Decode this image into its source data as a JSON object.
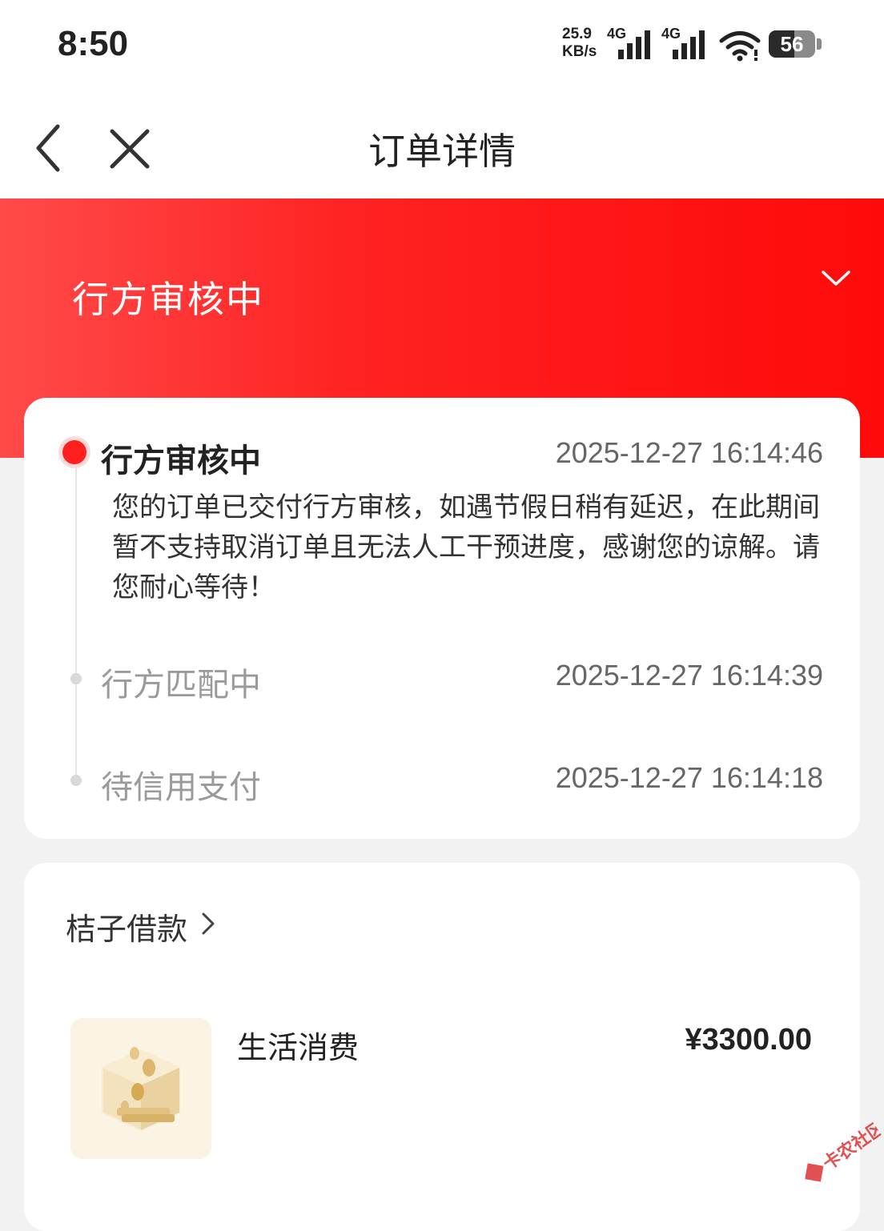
{
  "status_bar": {
    "time": "8:50",
    "net_speed_value": "25.9",
    "net_speed_unit": "KB/s",
    "sim1_label": "4G",
    "sim2_label": "4G",
    "battery_level": "56",
    "icons": [
      "signal-icon",
      "signal-icon",
      "wifi-icon",
      "battery-icon"
    ]
  },
  "nav": {
    "title": "订单详情",
    "back_icon": "chevron-left-icon",
    "close_icon": "close-icon"
  },
  "banner": {
    "status_title": "行方审核中",
    "expand_icon": "chevron-down-icon",
    "colors": {
      "from": "#ff4a4a",
      "to": "#ff0a0a"
    }
  },
  "timeline": {
    "steps": [
      {
        "title": "行方审核中",
        "time": "2025-12-27 16:14:46",
        "description": "您的订单已交付行方审核，如遇节假日稍有延迟，在此期间暂不支持取消订单且无法人工干预进度，感谢您的谅解。请您耐心等待！",
        "active": true
      },
      {
        "title": "行方匹配中",
        "time": "2025-12-27 16:14:39",
        "active": false
      },
      {
        "title": "待信用支付",
        "time": "2025-12-27 16:14:18",
        "active": false
      }
    ],
    "active_color": "#ff1f1f"
  },
  "product": {
    "merchant": "桔子借款",
    "merchant_icon": "chevron-right-icon",
    "name": "生活消费",
    "price": "¥3300.00",
    "image_icon": "coin-box-icon"
  },
  "watermark": {
    "text": "卡农社区"
  }
}
